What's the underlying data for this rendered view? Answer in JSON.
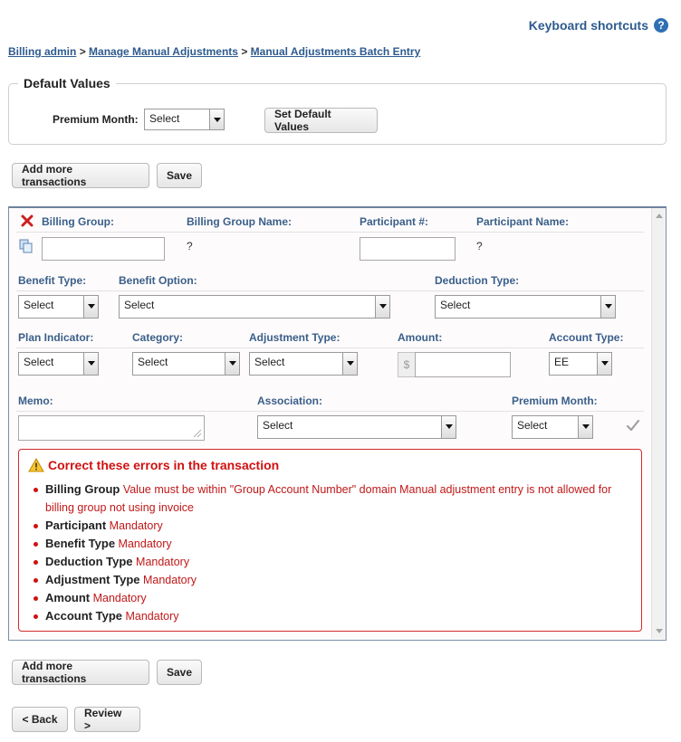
{
  "header": {
    "keyboard_shortcuts": "Keyboard shortcuts",
    "help_icon": "?"
  },
  "breadcrumb": {
    "items": [
      "Billing admin",
      "Manage Manual Adjustments",
      "Manual Adjustments Batch Entry"
    ],
    "separator": ">"
  },
  "defaults": {
    "legend": "Default Values",
    "premium_month_label": "Premium Month:",
    "premium_month_value": "Select",
    "set_default_button": "Set Default Values"
  },
  "actions": {
    "add_more": "Add more transactions",
    "save": "Save",
    "back": "< Back",
    "review": "Review >"
  },
  "transaction": {
    "billing_group_label": "Billing Group:",
    "billing_group_name_label": "Billing Group Name:",
    "billing_group_name_value": "?",
    "participant_num_label": "Participant #:",
    "participant_name_label": "Participant Name:",
    "participant_name_value": "?",
    "benefit_type_label": "Benefit Type:",
    "benefit_type_value": "Select",
    "benefit_option_label": "Benefit Option:",
    "benefit_option_value": "Select",
    "deduction_type_label": "Deduction Type:",
    "deduction_type_value": "Select",
    "plan_indicator_label": "Plan Indicator:",
    "plan_indicator_value": "Select",
    "category_label": "Category:",
    "category_value": "Select",
    "adjustment_type_label": "Adjustment Type:",
    "adjustment_type_value": "Select",
    "amount_label": "Amount:",
    "amount_prefix": "$",
    "account_type_label": "Account Type:",
    "account_type_value": "EE",
    "memo_label": "Memo:",
    "association_label": "Association:",
    "association_value": "Select",
    "premium_month_label": "Premium Month:",
    "premium_month_value": "Select"
  },
  "errors": {
    "title": "Correct these errors in the transaction",
    "items": [
      {
        "field": "Billing Group",
        "message": "Value must be within \"Group Account Number\" domain Manual adjustment entry is not allowed for billing group not using invoice"
      },
      {
        "field": "Participant",
        "message": "Mandatory"
      },
      {
        "field": "Benefit Type",
        "message": "Mandatory"
      },
      {
        "field": "Deduction Type",
        "message": "Mandatory"
      },
      {
        "field": "Adjustment Type",
        "message": "Mandatory"
      },
      {
        "field": "Amount",
        "message": "Mandatory"
      },
      {
        "field": "Account Type",
        "message": "Mandatory"
      }
    ]
  },
  "colors": {
    "link": "#2d5b8e",
    "label": "#3a5f8a",
    "error": "#d01010"
  }
}
